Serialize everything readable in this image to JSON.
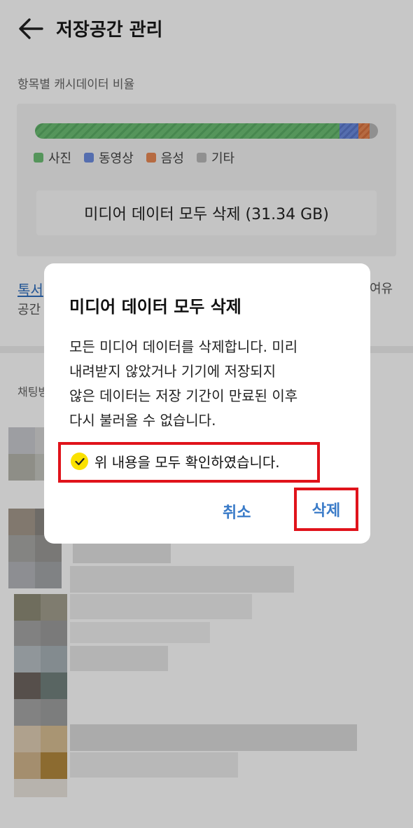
{
  "header": {
    "title": "저장공간 관리",
    "back_icon": "arrow-left-icon"
  },
  "cache_ratio": {
    "label": "항목별 캐시데이터 비율",
    "segments": [
      {
        "name": "사진",
        "share": 0.887,
        "color": "#6dbf75"
      },
      {
        "name": "동영상",
        "share": 0.055,
        "color": "#6e8de0"
      },
      {
        "name": "음성",
        "share": 0.033,
        "color": "#ea8a55"
      },
      {
        "name": "기타",
        "share": 0.025,
        "color": "#b9b9b9"
      }
    ],
    "delete_media_button": "미디어 데이터 모두 삭제 (31.34 GB)"
  },
  "talkdrawer": {
    "link_partial": "톡서",
    "space_partial": "공간",
    "free_partial": "여유"
  },
  "chat_section": {
    "label_partial": "채팅방"
  },
  "dialog": {
    "title": "미디어 데이터 모두 삭제",
    "body": "모든 미디어 데이터를 삭제합니다. 미리\n내려받지 않았거나 기기에 저장되지\n않은 데이터는 저장 기간이 만료된 이후\n다시 불러올 수 없습니다.",
    "confirm_label": "위 내용을 모두 확인하였습니다.",
    "confirm_checked": true,
    "cancel_label": "취소",
    "delete_label": "삭제",
    "accent_color": "#3a7bc8",
    "highlight_color": "#e0131b"
  }
}
